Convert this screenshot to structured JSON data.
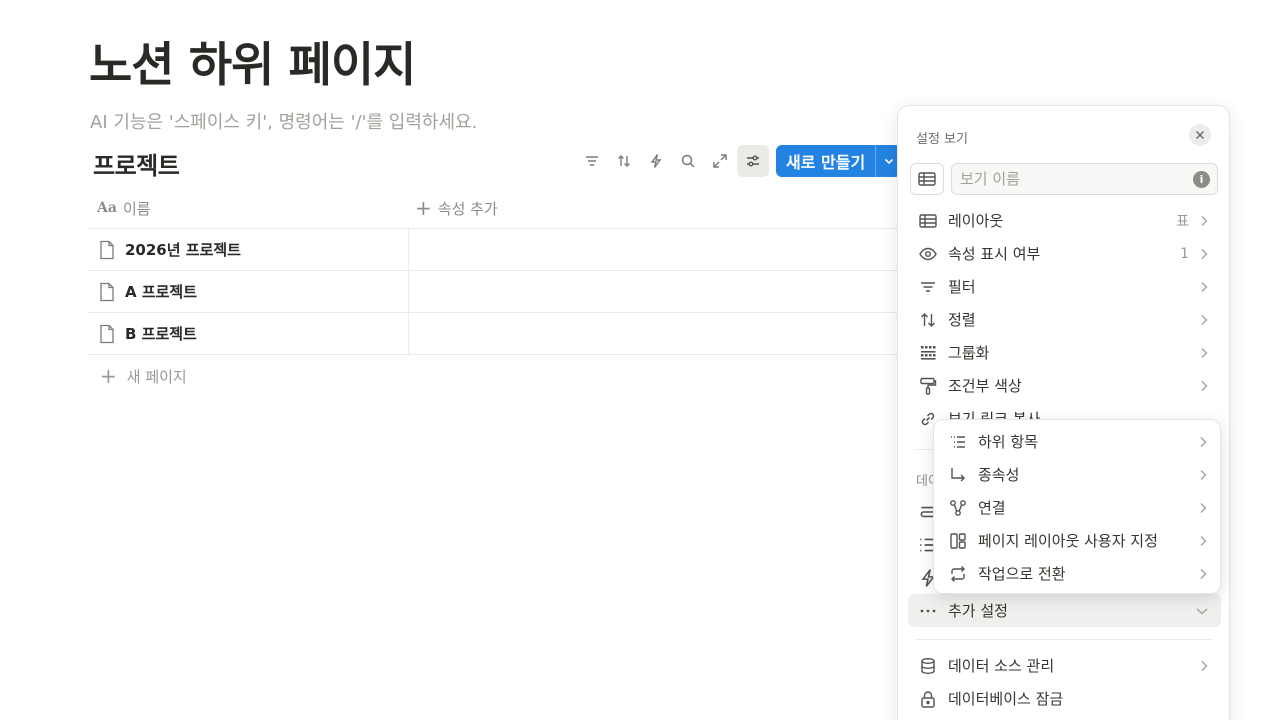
{
  "page": {
    "title": "노션 하위 페이지",
    "hint": "AI 기능은 '스페이스 키', 명령어는 '/'를 입력하세요."
  },
  "database": {
    "title": "프로젝트",
    "new_button_label": "새로 만들기",
    "columns": {
      "name_icon": "Aa",
      "name": "이름",
      "add_property": "속성 추가"
    },
    "rows": [
      {
        "name": "2026년 프로젝트"
      },
      {
        "name": "A 프로젝트"
      },
      {
        "name": "B 프로젝트"
      }
    ],
    "new_page_label": "새 페이지",
    "toolbar_icons": [
      "filter-icon",
      "sort-icon",
      "automation-icon",
      "search-icon",
      "expand-icon",
      "settings-sliders-icon"
    ]
  },
  "view_settings": {
    "header": "설정 보기",
    "view_name_placeholder": "보기 이름",
    "items": [
      {
        "label": "레이아웃",
        "value": "표",
        "icon": "table-icon"
      },
      {
        "label": "속성 표시 여부",
        "value": "1",
        "icon": "eye-icon"
      },
      {
        "label": "필터",
        "value": "",
        "icon": "filter-icon"
      },
      {
        "label": "정렬",
        "value": "",
        "icon": "sort-icon"
      },
      {
        "label": "그룹화",
        "value": "",
        "icon": "grid-icon"
      },
      {
        "label": "조건부 색상",
        "value": "",
        "icon": "paint-roller-icon"
      },
      {
        "label": "보기 링크 복사",
        "value": "",
        "icon": "link-icon"
      }
    ],
    "section_label": "데이",
    "more_settings": "추가 설정",
    "bottom_items": [
      {
        "label": "데이터 소스 관리",
        "icon": "database-icon"
      },
      {
        "label": "데이터베이스 잠금",
        "icon": "lock-icon"
      }
    ]
  },
  "submenu": {
    "items": [
      {
        "label": "하위 항목",
        "icon": "sub-items-icon"
      },
      {
        "label": "종속성",
        "icon": "dependency-arrow-icon"
      },
      {
        "label": "연결",
        "icon": "connection-icon"
      },
      {
        "label": "페이지 레이아웃 사용자 지정",
        "icon": "page-layout-icon"
      },
      {
        "label": "작업으로 전환",
        "icon": "convert-icon"
      }
    ]
  }
}
